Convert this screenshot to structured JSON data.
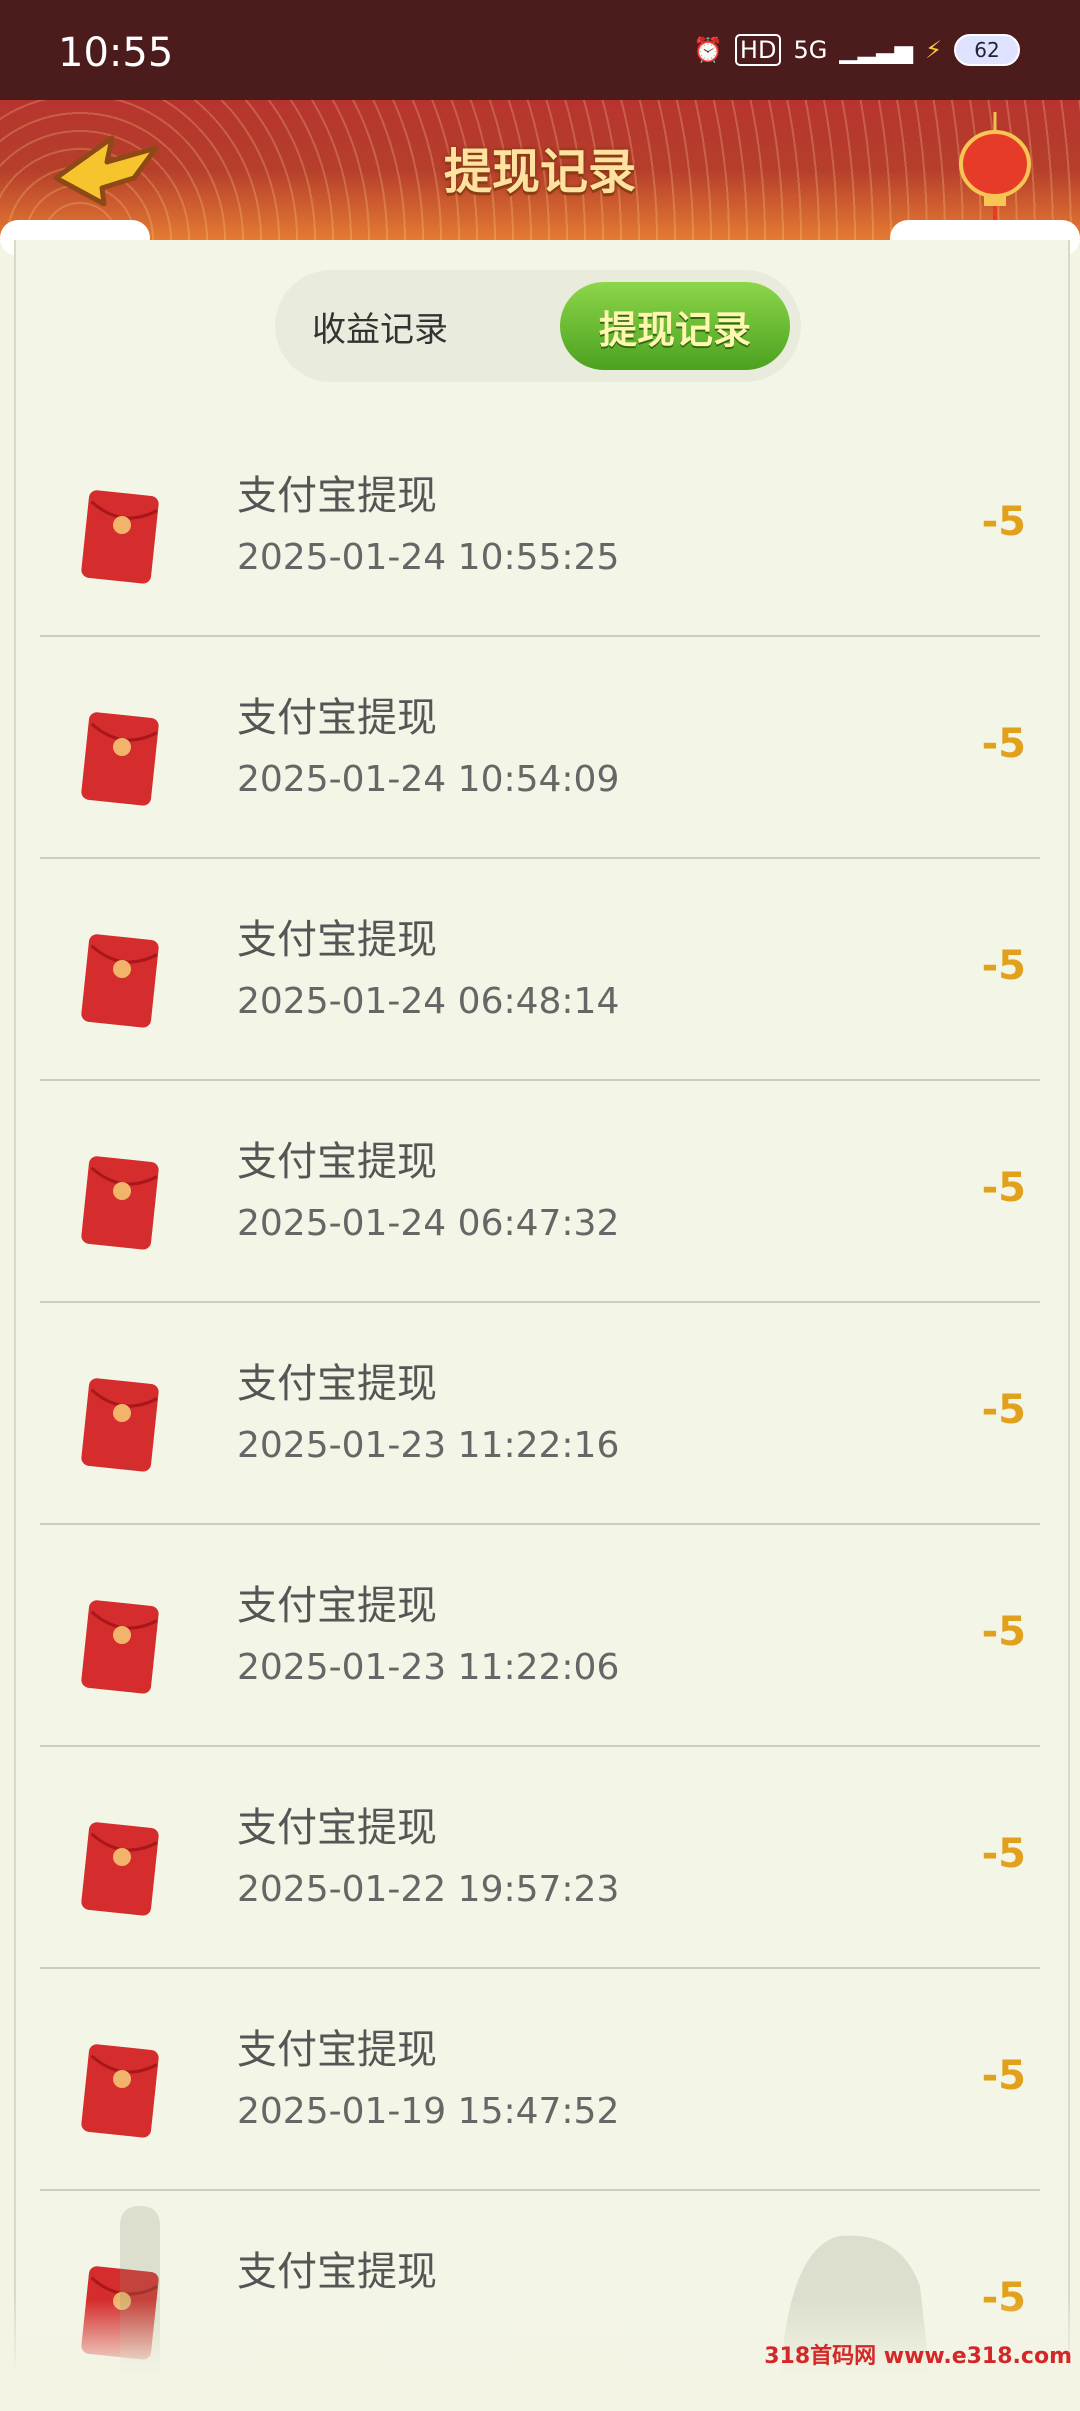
{
  "status_bar": {
    "time": "10:55",
    "battery": "62",
    "network": "5G",
    "hd": "HD"
  },
  "header": {
    "title": "提现记录"
  },
  "tabs": {
    "income": "收益记录",
    "withdraw": "提现记录"
  },
  "records": [
    {
      "title": "支付宝提现",
      "time": "2025-01-24 10:55:25",
      "amount": "-5"
    },
    {
      "title": "支付宝提现",
      "time": "2025-01-24 10:54:09",
      "amount": "-5"
    },
    {
      "title": "支付宝提现",
      "time": "2025-01-24 06:48:14",
      "amount": "-5"
    },
    {
      "title": "支付宝提现",
      "time": "2025-01-24 06:47:32",
      "amount": "-5"
    },
    {
      "title": "支付宝提现",
      "time": "2025-01-23 11:22:16",
      "amount": "-5"
    },
    {
      "title": "支付宝提现",
      "time": "2025-01-23 11:22:06",
      "amount": "-5"
    },
    {
      "title": "支付宝提现",
      "time": "2025-01-22 19:57:23",
      "amount": "-5"
    },
    {
      "title": "支付宝提现",
      "time": "2025-01-19 15:47:52",
      "amount": "-5"
    },
    {
      "title": "支付宝提现",
      "time": "",
      "amount": "-5"
    }
  ],
  "watermark": "318首码网 www.e318.com",
  "colors": {
    "header": "#b7342e",
    "accent_amount": "#e2a11c",
    "tab_active": "#5fb02b"
  }
}
